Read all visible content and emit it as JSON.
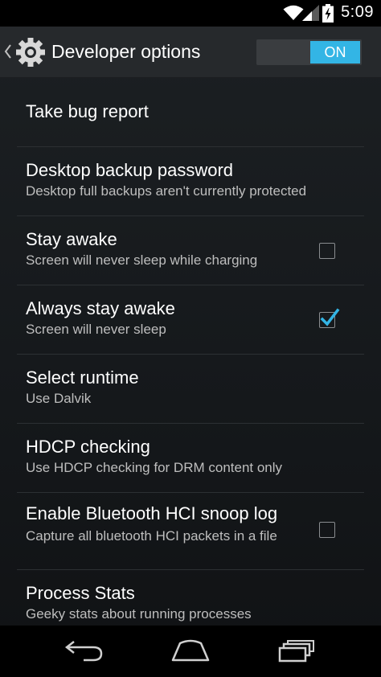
{
  "status_bar": {
    "time": "5:09",
    "icons": [
      "wifi-icon",
      "cell-signal-icon",
      "battery-charging-icon"
    ]
  },
  "action_bar": {
    "title": "Developer options",
    "icon": "settings-gear-icon",
    "toggle_label": "ON"
  },
  "preferences": [
    {
      "title": "Take bug report",
      "summary": ""
    },
    {
      "title": "Desktop backup password",
      "summary": "Desktop full backups aren't currently protected"
    },
    {
      "title": "Stay awake",
      "summary": "Screen will never sleep while charging",
      "checked": false
    },
    {
      "title": "Always stay awake",
      "summary": "Screen will never sleep",
      "checked": true
    },
    {
      "title": "Select runtime",
      "summary": "Use Dalvik"
    },
    {
      "title": "HDCP checking",
      "summary": "Use HDCP checking for DRM content only"
    },
    {
      "title": "Enable Bluetooth HCI snoop log",
      "summary": "Capture all bluetooth HCI packets in a file",
      "checked": false
    },
    {
      "title": "Process Stats",
      "summary": "Geeky stats about running processes"
    }
  ],
  "nav_bar": {
    "icons": [
      "back-icon",
      "home-icon",
      "recent-apps-icon"
    ]
  },
  "colors": {
    "accent": "#33b5e5",
    "background": "#1a1d20",
    "action_bar": "#26292c"
  }
}
